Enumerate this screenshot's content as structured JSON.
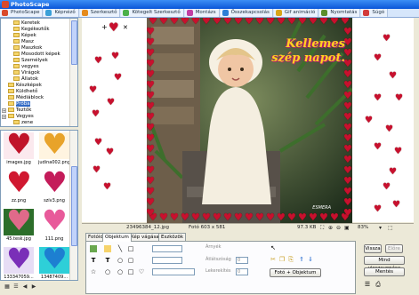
{
  "window": {
    "title": "PhotoScape"
  },
  "tabs": [
    {
      "label": "PhotoScape",
      "color": "#d94a2b"
    },
    {
      "label": "Képnéző",
      "color": "#3aa0d8"
    },
    {
      "label": "Szerkesztő",
      "color": "#e58b1f"
    },
    {
      "label": "Kötegelt Szerkesztő",
      "color": "#4ab04a"
    },
    {
      "label": "Montázs",
      "color": "#c23fa3"
    },
    {
      "label": "Összekapcsolás",
      "color": "#2c7fd6"
    },
    {
      "label": "Gif animáció",
      "color": "#d8a41a"
    },
    {
      "label": "Nyomtatás",
      "color": "#5a8e2c"
    },
    {
      "label": "Súgó",
      "color": "#d23b3b"
    }
  ],
  "tree": [
    {
      "label": "Keretek",
      "indent": 2
    },
    {
      "label": "Kegékeztők",
      "indent": 2
    },
    {
      "label": "Képek",
      "indent": 2
    },
    {
      "label": "Masz",
      "indent": 2
    },
    {
      "label": "Maszkok",
      "indent": 2
    },
    {
      "label": "Mosodott képek",
      "indent": 2
    },
    {
      "label": "Személyek",
      "indent": 2
    },
    {
      "label": "vegyes",
      "indent": 2
    },
    {
      "label": "Virágok",
      "indent": 2
    },
    {
      "label": "Állatok",
      "indent": 2
    },
    {
      "label": "Készképek",
      "indent": 1
    },
    {
      "label": "Küldhető",
      "indent": 1
    },
    {
      "label": "Médiáblock",
      "indent": 1
    },
    {
      "label": "Próba",
      "indent": 1,
      "selected": true
    },
    {
      "label": "Teztők",
      "indent": 1
    },
    {
      "label": "Vegyes",
      "indent": 1
    },
    {
      "label": "zene",
      "indent": 2
    }
  ],
  "thumbnails": [
    {
      "caption": "images.jpg",
      "color": "#c0142a",
      "bg": "#fbe9ee"
    },
    {
      "caption": "judina002.png",
      "color": "#e8a32a",
      "bg": "#fff4e0"
    },
    {
      "caption": "zz.png",
      "color": "#d01830",
      "bg": "#ffffff"
    },
    {
      "caption": "szív3.png",
      "color": "#c41c5a",
      "bg": "#ffffff"
    },
    {
      "caption": "45.tesk.jpg",
      "color": "#e06a8a",
      "bg": "#2c6e2a"
    },
    {
      "caption": "111.png",
      "color": "#e85a9a",
      "bg": "#ffffff"
    },
    {
      "caption": "133347059...",
      "color": "#7a2fb8",
      "bg": "#e7ddf5"
    },
    {
      "caption": "13487409...",
      "color": "#1d7fd1",
      "bg": "#2ecfd8"
    }
  ],
  "editor": {
    "greeting_line1": "Kellemes",
    "greeting_line2": "szép napot.",
    "signature": "ESMERA",
    "filename": "23496384_12.jpg",
    "photo_info": "Fotó 603 x 581",
    "filesize": "97.3 KB",
    "zoom": "83%"
  },
  "panel": {
    "tabs": [
      "Fotóid",
      "Objektum",
      "Kép vágása",
      "Eszközök"
    ],
    "active_tab": 1,
    "labels": {
      "arnyek": "Árnyék",
      "atlatszo": "Átlátszóság",
      "lekerekites": "Lekerekítés"
    },
    "values": {
      "atlatszo": "0",
      "lekerekites": "0"
    },
    "photo_obj_button": "Fotó + Objektum",
    "buttons": {
      "vissza": "Vissza",
      "elore": "Előre",
      "mind_vissza": "Mind visszavonása",
      "mentes": "Mentés"
    }
  }
}
